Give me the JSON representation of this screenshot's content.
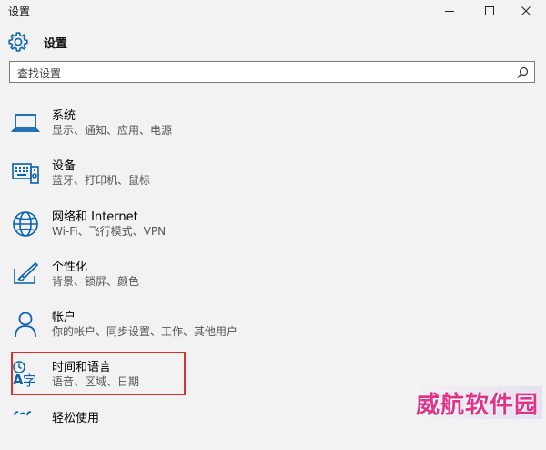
{
  "window": {
    "title": "设置",
    "controls": [
      "minimize",
      "maximize",
      "close"
    ]
  },
  "header": {
    "icon": "gear-icon",
    "title": "设置"
  },
  "search": {
    "placeholder": "查找设置",
    "icon": "search-icon"
  },
  "categories": [
    {
      "name": "系统",
      "desc": "显示、通知、应用、电源",
      "icon": "laptop-icon"
    },
    {
      "name": "设备",
      "desc": "蓝牙、打印机、鼠标",
      "icon": "keyboard-device-icon"
    },
    {
      "name": "网络和 Internet",
      "desc": "Wi-Fi、飞行模式、VPN",
      "icon": "globe-icon"
    },
    {
      "name": "个性化",
      "desc": "背景、锁屏、颜色",
      "icon": "personalization-icon"
    },
    {
      "name": "帐户",
      "desc": "你的帐户、同步设置、工作、其他用户",
      "icon": "person-icon"
    },
    {
      "name": "时间和语言",
      "desc": "语音、区域、日期",
      "icon": "time-language-icon"
    },
    {
      "name": "轻松使用",
      "desc": "",
      "icon": "ease-of-access-icon"
    }
  ],
  "colors": {
    "accent": "#0a62b0",
    "highlight_border": "#d9302a",
    "watermark": "#e0348a"
  },
  "watermark": {
    "text": "威航软件园"
  }
}
